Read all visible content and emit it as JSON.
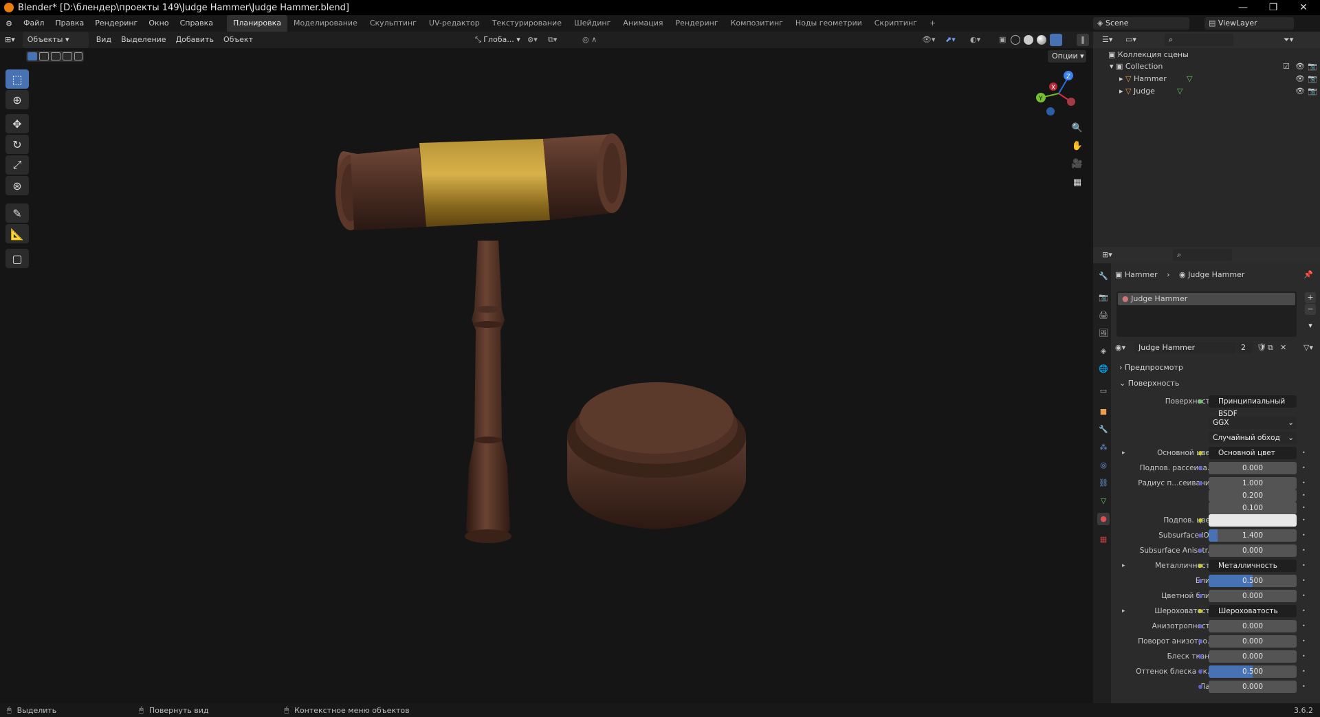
{
  "window": {
    "title": "Blender* [D:\\блендер\\проекты 149\\Judge Hammer\\Judge Hammer.blend]",
    "minimize": "—",
    "maximize": "❐",
    "close": "✕"
  },
  "menu": [
    "Файл",
    "Правка",
    "Рендеринг",
    "Окно",
    "Справка"
  ],
  "workspaces": [
    {
      "label": "Планировка",
      "active": true
    },
    {
      "label": "Моделирование"
    },
    {
      "label": "Скульптинг"
    },
    {
      "label": "UV-редактор"
    },
    {
      "label": "Текстурирование"
    },
    {
      "label": "Шейдинг"
    },
    {
      "label": "Анимация"
    },
    {
      "label": "Рендеринг"
    },
    {
      "label": "Композитинг"
    },
    {
      "label": "Ноды геометрии"
    },
    {
      "label": "Скриптинг"
    }
  ],
  "add_workspace": "+",
  "scene_selector": {
    "label": "Scene"
  },
  "viewlayer_selector": {
    "label": "ViewLayer"
  },
  "viewport_header": {
    "mode": "Объекты",
    "menus": [
      "Вид",
      "Выделение",
      "Добавить",
      "Объект"
    ],
    "orientation": "Глоба...",
    "options": "Опции"
  },
  "outliner": {
    "scene_collection": "Коллекция сцены",
    "collection": "Collection",
    "items": [
      {
        "name": "Hammer"
      },
      {
        "name": "Judge"
      }
    ]
  },
  "properties": {
    "breadcrumb_object": "Hammer",
    "breadcrumb_material": "Judge Hammer",
    "slot_name": "Judge Hammer",
    "material_name": "Judge Hammer",
    "users": "2",
    "panels": {
      "preview": "Предпросмотр",
      "surface": "Поверхность"
    },
    "surface_label": "Поверхность",
    "surface_value": "Принципиальный BSDF",
    "distribution": "GGX",
    "subsurface_method": "Случайный обход",
    "rows": [
      {
        "label": "Основной цвет",
        "value": "Основной цвет",
        "kind": "node",
        "expand": true
      },
      {
        "label": "Подпов. рассеива...",
        "value": "0.000",
        "kind": "num"
      },
      {
        "label": "Радиус п...сеивания",
        "value": "1.000",
        "kind": "num"
      },
      {
        "label": "",
        "value": "0.200",
        "kind": "num"
      },
      {
        "label": "",
        "value": "0.100",
        "kind": "num"
      },
      {
        "label": "Подпов. цвет",
        "value": "",
        "kind": "white"
      },
      {
        "label": "Subsurface IOR",
        "value": "1.400",
        "kind": "num",
        "fill": 0.1
      },
      {
        "label": "Subsurface Anisotr...",
        "value": "0.000",
        "kind": "num"
      },
      {
        "label": "Металличность",
        "value": "Металличность",
        "kind": "node",
        "expand": true
      },
      {
        "label": "Блик",
        "value": "0.500",
        "kind": "num",
        "fill": 0.5
      },
      {
        "label": "Цветной блик",
        "value": "0.000",
        "kind": "num"
      },
      {
        "label": "Шероховатость",
        "value": "Шероховатость",
        "kind": "node",
        "expand": true
      },
      {
        "label": "Анизотропность",
        "value": "0.000",
        "kind": "num"
      },
      {
        "label": "Поворот анизотро...",
        "value": "0.000",
        "kind": "num"
      },
      {
        "label": "Блеск ткани",
        "value": "0.000",
        "kind": "num"
      },
      {
        "label": "Оттенок блеска тк...",
        "value": "0.500",
        "kind": "num",
        "fill": 0.5
      },
      {
        "label": "Лак",
        "value": "0.000",
        "kind": "num"
      }
    ]
  },
  "statusbar": {
    "select": "Выделить",
    "rotate": "Повернуть вид",
    "context": "Контекстное меню объектов",
    "version": "3.6.2"
  },
  "gizmo": {
    "x": "X",
    "y": "Y",
    "z": "Z"
  },
  "colors": {
    "accent": "#4772b3",
    "orange": "#e87d0d"
  }
}
